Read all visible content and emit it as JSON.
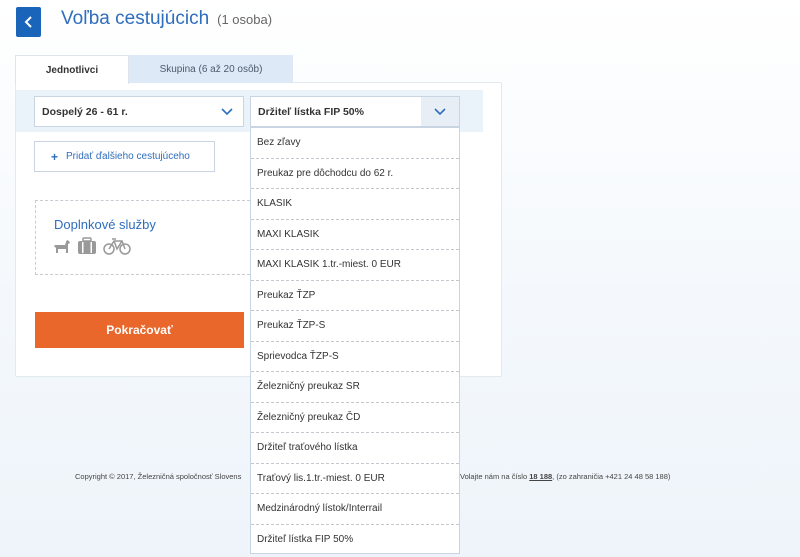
{
  "header": {
    "back_icon": "chevron-left-icon",
    "title": "Voľba cestujúcich",
    "subtitle": "(1 osoba)"
  },
  "tabs": [
    {
      "label": "Jednotlivci",
      "active": true
    },
    {
      "label": "Skupina (6 až 20 osôb)",
      "active": false
    }
  ],
  "passenger": {
    "category_selected": "Dospelý 26 - 61 r.",
    "discount_selected": "Držiteľ lístka FIP 50%"
  },
  "add_passenger": {
    "plus": "+",
    "label": "Pridať ďalšieho cestujúceho"
  },
  "services": {
    "label": "Doplnkové služby",
    "icons": [
      "dog-icon",
      "luggage-icon",
      "bicycle-icon"
    ]
  },
  "continue_button": "Pokračovať",
  "discount_options": [
    "Bez zľavy",
    "Preukaz pre dôchodcu do 62 r.",
    "KLASIK",
    "MAXI KLASIK",
    "MAXI KLASIK 1.tr.-miest. 0 EUR",
    "Preukaz ŤZP",
    "Preukaz ŤZP-S",
    "Sprievodca ŤZP-S",
    "Železničný preukaz SR",
    "Železničný preukaz ČD",
    "Držiteľ traťového lístka",
    "Traťový lis.1.tr.-miest. 0 EUR",
    "Medzinárodný lístok/Interrail",
    "Držiteľ lístka FIP 50%"
  ],
  "footer": {
    "copyright": "Copyright © 2017, Železničná spoločnosť Slovens",
    "call_prefix": "Volajte nám na číslo",
    "phone": "18 188",
    "abroad": "(zo zahraničia +421 24 48 58 188)"
  },
  "colors": {
    "primary": "#1a64b9",
    "accent": "#e9672a",
    "link": "#2f6dbd"
  }
}
